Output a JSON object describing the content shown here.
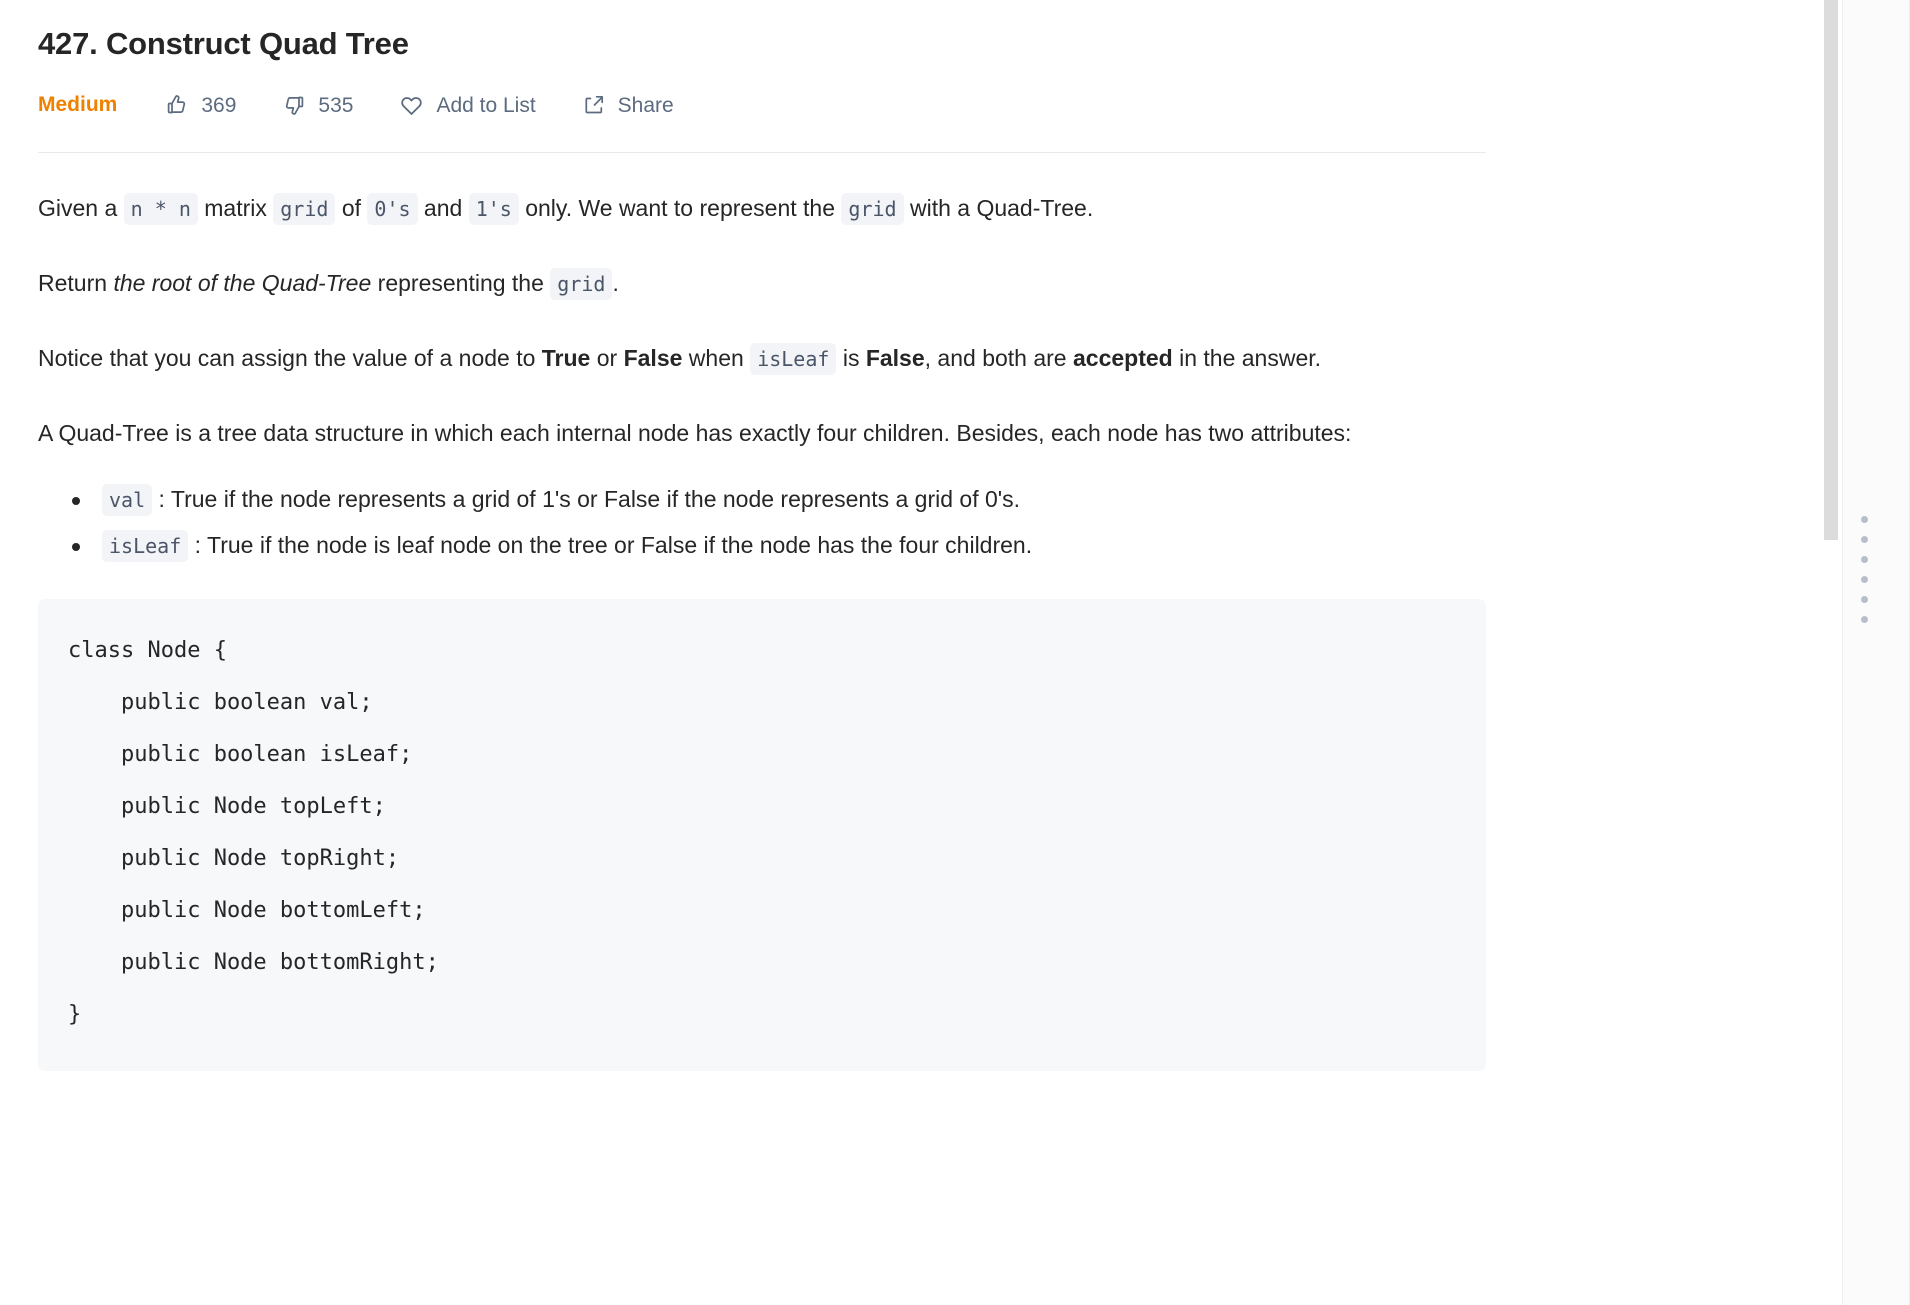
{
  "problem": {
    "title": "427. Construct Quad Tree",
    "difficulty": "Medium",
    "likes": "369",
    "dislikes": "535",
    "add_to_list_label": "Add to List",
    "share_label": "Share"
  },
  "description": {
    "p1": {
      "t1": "Given a ",
      "c1": "n * n",
      "t2": " matrix ",
      "c2": "grid",
      "t3": " of ",
      "c3": "0's",
      "t4": " and ",
      "c4": "1's",
      "t5": " only. We want to represent the ",
      "c5": "grid",
      "t6": " with a Quad-Tree."
    },
    "p2": {
      "t1": "Return ",
      "em1": "the root of the Quad-Tree",
      "t2": " representing the ",
      "c1": "grid",
      "t3": "."
    },
    "p3": {
      "t1": "Notice that you can assign the value of a node to ",
      "b1": "True",
      "t2": " or ",
      "b2": "False",
      "t3": " when ",
      "c1": "isLeaf",
      "t4": " is ",
      "b3": "False",
      "t5": ", and both are ",
      "b4": "accepted",
      "t6": " in the answer."
    },
    "p4": "A Quad-Tree is a tree data structure in which each internal node has exactly four children. Besides, each node has two attributes:",
    "bullets": [
      {
        "code": "val",
        "text": ": True if the node represents a grid of 1's or False if the node represents a grid of 0's."
      },
      {
        "code": "isLeaf",
        "text": ": True if the node is leaf node on the tree or False if the node has the four children."
      }
    ],
    "code_block": "class Node {\n    public boolean val;\n    public boolean isLeaf;\n    public Node topLeft;\n    public Node topRight;\n    public Node bottomLeft;\n    public Node bottomRight;\n}"
  },
  "colors": {
    "difficulty": "#ef8100",
    "meta_text": "#5c6b7f",
    "body_text": "#262626",
    "code_bg": "#f7f8fa",
    "inline_code_bg": "#f2f4f7"
  },
  "icons": {
    "thumbs_up": "thumbs-up-icon",
    "thumbs_down": "thumbs-down-icon",
    "heart": "heart-icon",
    "share": "share-icon"
  }
}
